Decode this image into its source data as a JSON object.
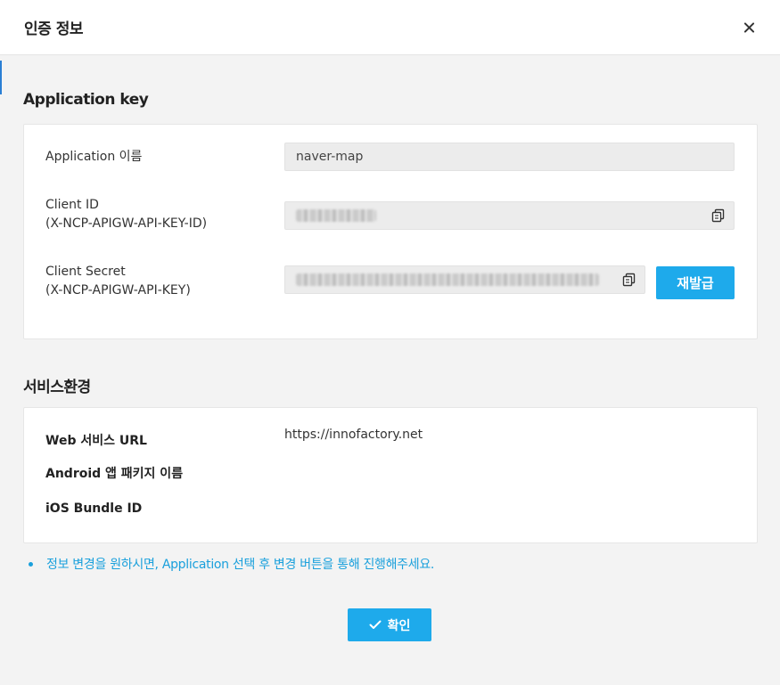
{
  "modal": {
    "title": "인증 정보"
  },
  "app_key": {
    "section_title": "Application key",
    "rows": [
      {
        "label": "Application 이름",
        "value": "naver-map"
      },
      {
        "label_line1": "Client ID",
        "label_line2": "(X-NCP-APIGW-API-KEY-ID)",
        "value": ""
      },
      {
        "label_line1": "Client Secret",
        "label_line2": "(X-NCP-APIGW-API-KEY)",
        "value": ""
      }
    ],
    "reissue_label": "재발급"
  },
  "service_env": {
    "section_title": "서비스환경",
    "rows": [
      {
        "label": "Web 서비스 URL",
        "value": "https://innofactory.net"
      },
      {
        "label": "Android 앱 패키지 이름",
        "value": ""
      },
      {
        "label": "iOS Bundle ID",
        "value": ""
      }
    ]
  },
  "notice": "정보 변경을 원하시면, Application 선택 후 변경 버튼을 통해 진행해주세요.",
  "confirm_label": "확인",
  "colors": {
    "accent": "#1eaaeb",
    "notice": "#1aa0dc"
  },
  "icons": {
    "close": "close-icon",
    "copy": "copy-icon",
    "check": "check-icon"
  }
}
